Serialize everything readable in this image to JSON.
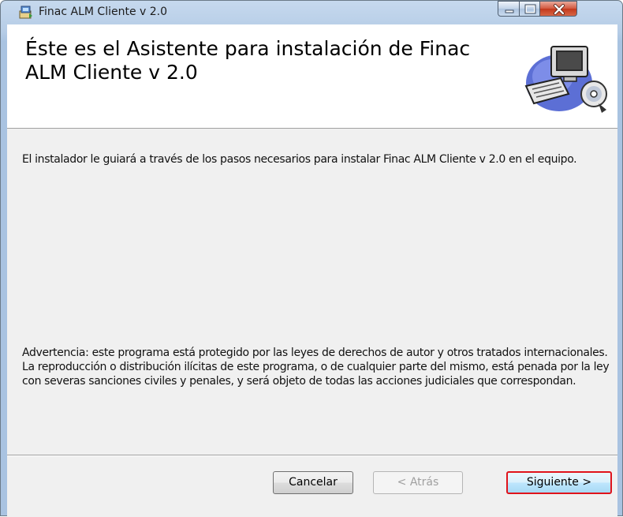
{
  "window": {
    "title": "Finac ALM Cliente v 2.0"
  },
  "header": {
    "title": "Éste es el Asistente para instalación de Finac ALM Cliente v 2.0",
    "graphic": "computer-setup-icon"
  },
  "body": {
    "intro": "El instalador le guiará a través de los pasos necesarios para instalar Finac ALM Cliente v 2.0 en el equipo.",
    "warning": "Advertencia: este programa está protegido por las leyes de derechos de autor y otros tratados internacionales. La reproducción o distribución ilícitas de este programa, o de cualquier parte del mismo, está penada por la ley con severas sanciones civiles y penales, y será objeto de todas las acciones judiciales que correspondan."
  },
  "buttons": {
    "cancel": "Cancelar",
    "back": "< Atrás",
    "next": "Siguiente >"
  },
  "colors": {
    "highlight_border": "#e0131b",
    "title_bar": "#b5cce6",
    "close_button": "#c3381c"
  }
}
